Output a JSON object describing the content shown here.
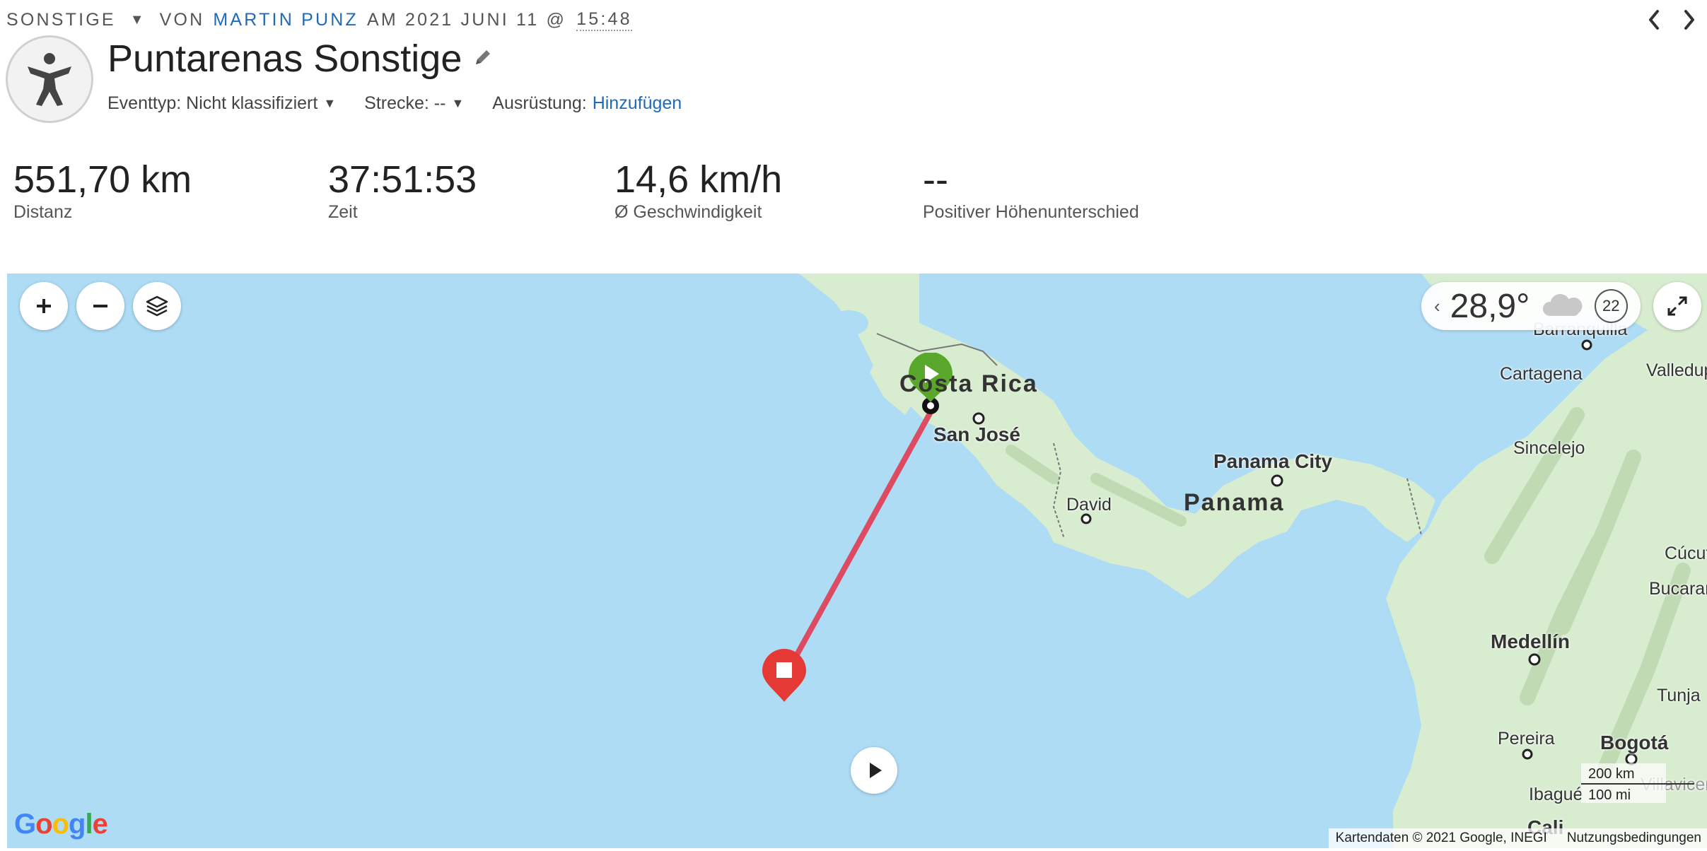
{
  "header": {
    "category": "SONSTIGE",
    "by": "VON",
    "author": "MARTIN PUNZ",
    "at": "AM 2021 JUNI 11 @",
    "time": "15:48",
    "title": "Puntarenas Sonstige",
    "icons": {
      "activity": "person-activity-icon",
      "edit": "pencil-icon",
      "prev": "chevron-left-icon",
      "next": "chevron-right-icon"
    }
  },
  "meta": {
    "event_label": "Eventtyp: Nicht klassifiziert",
    "course_label": "Strecke: --",
    "gear_label": "Ausrüstung:",
    "gear_link": "Hinzufügen"
  },
  "stats": [
    {
      "value": "551,70 km",
      "label": "Distanz"
    },
    {
      "value": "37:51:53",
      "label": "Zeit"
    },
    {
      "value": "14,6 km/h",
      "label": "Ø Geschwindigkeit"
    },
    {
      "value": "--",
      "label": "Positiver Höhenunterschied"
    }
  ],
  "map": {
    "controls": {
      "zoom_in": "plus-icon",
      "zoom_out": "minus-icon",
      "layers": "layers-icon",
      "expand": "expand-icon",
      "playback": "play-icon"
    },
    "weather": {
      "temperature": "28,9°",
      "wind": "22",
      "icon": "cloud-icon"
    },
    "labels": {
      "costa_rica": "Costa Rica",
      "panama": "Panama",
      "san_jose": "San José",
      "panama_city": "Panama City",
      "david": "David",
      "barranquilla": "Barranquilla",
      "cartagena": "Cartagena",
      "valledupar": "Valledupar",
      "sincelejo": "Sincelejo",
      "cucuta": "Cúcuta",
      "bucaramanga": "Bucaramanga",
      "medellin": "Medellín",
      "tunja": "Tunja",
      "pereira": "Pereira",
      "bogota": "Bogotá",
      "ibague": "Ibagué",
      "villavicencio": "Villavicencio",
      "cali": "Cali"
    },
    "scale": {
      "km": "200 km",
      "mi": "100 mi"
    },
    "attribution": "Kartendaten © 2021 Google, INEGI",
    "terms": "Nutzungsbedingungen",
    "logo": "Google",
    "colors": {
      "water": "#aedcf5",
      "land": "#d8ecd0",
      "route": "#dd4b63",
      "start": "#5aa82b",
      "end": "#e53935"
    }
  }
}
